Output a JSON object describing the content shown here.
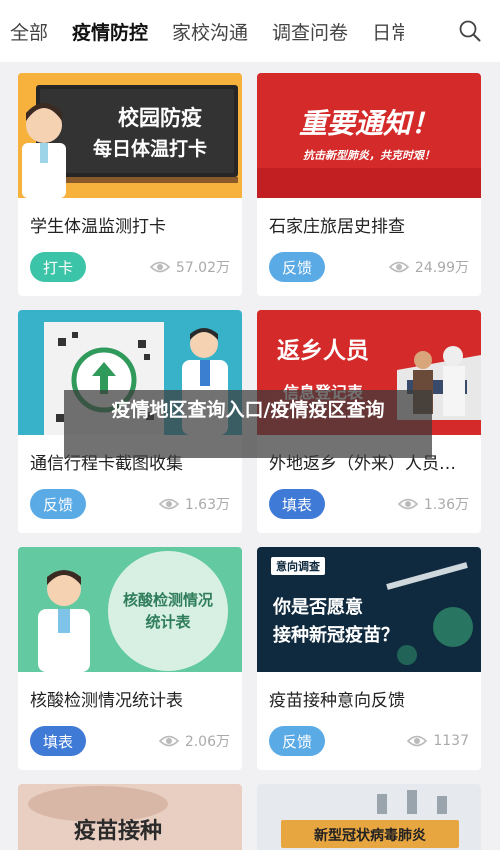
{
  "tabs": [
    "全部",
    "疫情防控",
    "家校沟通",
    "调查问卷",
    "日常"
  ],
  "active_tab_index": 1,
  "cards": [
    {
      "title": "学生体温监测打卡",
      "tag": "打卡",
      "tag_color": "#3cc4a8",
      "views": "57.02万",
      "thumb": {
        "line1": "校园防疫",
        "line2": "每日体温打卡"
      }
    },
    {
      "title": "石家庄旅居史排查",
      "tag": "反馈",
      "tag_color": "#5aaae6",
      "views": "24.99万",
      "thumb": {
        "line1": "重要通知！",
        "line2": "抗击新型肺炎，共克时艰！"
      }
    },
    {
      "title": "通信行程卡截图收集",
      "tag": "反馈",
      "tag_color": "#5aaae6",
      "views": "1.63万",
      "thumb": {}
    },
    {
      "title": "外地返乡（外来）人员信息登记",
      "tag": "填表",
      "tag_color": "#3f7ad6",
      "views": "1.36万",
      "thumb": {
        "line1": "返乡人员",
        "line2": "信息登记表"
      }
    },
    {
      "title": "核酸检测情况统计表",
      "tag": "填表",
      "tag_color": "#3f7ad6",
      "views": "2.06万",
      "thumb": {
        "line1": "核酸检测情况",
        "line2": "统计表"
      }
    },
    {
      "title": "疫苗接种意向反馈",
      "tag": "反馈",
      "tag_color": "#5aaae6",
      "views": "1137",
      "thumb": {
        "badge": "意向调查",
        "line1": "你是否愿意",
        "line2": "接种新冠疫苗？"
      }
    },
    {
      "title": "",
      "thumb": {
        "line1": "疫苗接种"
      }
    },
    {
      "title": "",
      "thumb": {
        "line1": "新型冠状病毒肺炎"
      }
    }
  ],
  "overlay_caption": "疫情地区查询入口/疫情疫区查询"
}
